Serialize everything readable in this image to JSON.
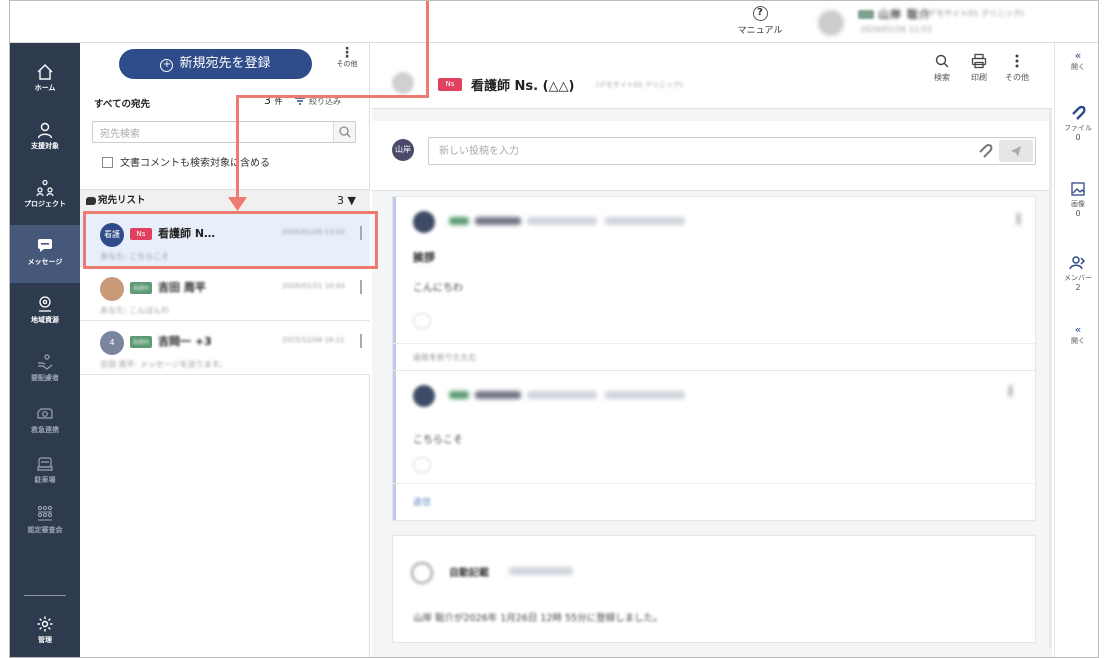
{
  "topbar": {
    "manual_label": "マニュアル",
    "user_name": "山岸 聡介",
    "user_org": "(デモサイト01 クリニック)",
    "user_time": "2026/01/26 12:53"
  },
  "nav": {
    "items": [
      {
        "label": "ホーム",
        "icon": "home-icon"
      },
      {
        "label": "支援対象",
        "icon": "person-icon"
      },
      {
        "label": "プロジェクト",
        "icon": "project-icon"
      },
      {
        "label": "メッセージ",
        "icon": "message-icon"
      },
      {
        "label": "地域資源",
        "icon": "map-pin-icon"
      },
      {
        "label": "要配慮者",
        "icon": "care-icon"
      },
      {
        "label": "救急連携",
        "icon": "ambulance-icon"
      },
      {
        "label": "駐車場",
        "icon": "car-icon"
      },
      {
        "label": "認定審査会",
        "icon": "committee-icon"
      },
      {
        "label": "管理",
        "icon": "gear-icon"
      }
    ]
  },
  "recipients": {
    "new_button": "新規宛先を登録",
    "other_label": "その他",
    "all_title": "すべての宛先",
    "count": "3",
    "count_unit": "件",
    "filter_label": "絞り込み",
    "search_placeholder": "宛先検索",
    "include_doc_comments": "文書コメントも検索対象に含める",
    "list_title": "宛先リスト",
    "list_count": "3 ▼",
    "rows": [
      {
        "avatar": "看護",
        "tag": "Ns",
        "name": "看護師 N…",
        "date": "2026/01/26 13:02",
        "preview": "あなた: こちらこそ"
      },
      {
        "avatar": "",
        "tag": "Adm",
        "name": "吉田 周平",
        "date": "2026/01/21 10:43",
        "preview": "あなた: こんばんわ"
      },
      {
        "avatar": "4",
        "tag": "Adm",
        "name": "吉岡一 +3",
        "date": "2025/12/08 16:11",
        "preview": "吉田 周平: メッセージを送ります。"
      }
    ]
  },
  "main": {
    "avatar": "看護",
    "tag": "Ns",
    "title": "看護師 Ns. (△△)",
    "org": "(デモサイト01 クリニック)",
    "tools": [
      {
        "label": "検索",
        "icon": "search-icon"
      },
      {
        "label": "印刷",
        "icon": "print-icon"
      },
      {
        "label": "その他",
        "icon": "more-icon"
      }
    ],
    "post_avatar": "山岸",
    "post_placeholder": "新しい投稿を入力",
    "card1_title": "挨拶",
    "card1_body": "こんにちわ",
    "collapse_label": "返信を折りたたむ",
    "reply_body": "こちらこそ",
    "reply_link": "返信",
    "auto_title": "自動記載",
    "auto_body": "山岸 聡介が2026年 1月26日 12時 55分に登録しました。"
  },
  "rpanel": {
    "open_label": "開く",
    "file_label": "ファイル",
    "file_count": "0",
    "image_label": "画像",
    "image_count": "0",
    "member_label": "メンバー",
    "member_count": "2",
    "open_label2": "開く"
  },
  "colors": {
    "nav_bg": "#2e3b4f",
    "primary": "#2f4c8a",
    "ns_tag": "#e0415f",
    "adm_tag": "#5b9a72",
    "highlight": "#ee7b72"
  }
}
